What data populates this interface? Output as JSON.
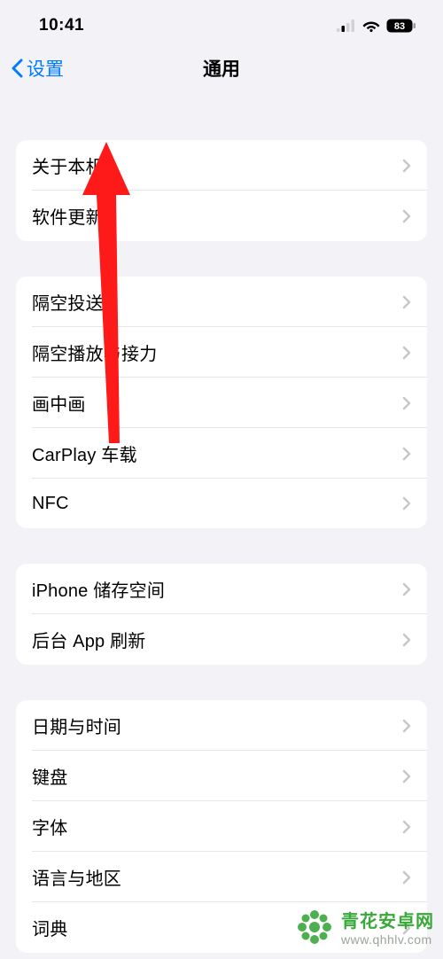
{
  "status": {
    "time": "10:41",
    "battery": "83"
  },
  "nav": {
    "back": "设置",
    "title": "通用"
  },
  "groups": [
    {
      "rows": [
        {
          "label": "关于本机",
          "name": "about"
        },
        {
          "label": "软件更新",
          "name": "software-update"
        }
      ]
    },
    {
      "rows": [
        {
          "label": "隔空投送",
          "name": "airdrop"
        },
        {
          "label": "隔空播放与接力",
          "name": "airplay-handoff"
        },
        {
          "label": "画中画",
          "name": "pip"
        },
        {
          "label": "CarPlay 车载",
          "name": "carplay"
        },
        {
          "label": "NFC",
          "name": "nfc"
        }
      ]
    },
    {
      "rows": [
        {
          "label": "iPhone 储存空间",
          "name": "iphone-storage"
        },
        {
          "label": "后台 App 刷新",
          "name": "background-refresh"
        }
      ]
    },
    {
      "rows": [
        {
          "label": "日期与时间",
          "name": "date-time"
        },
        {
          "label": "键盘",
          "name": "keyboard"
        },
        {
          "label": "字体",
          "name": "fonts"
        },
        {
          "label": "语言与地区",
          "name": "language-region"
        },
        {
          "label": "词典",
          "name": "dictionary"
        }
      ]
    }
  ],
  "watermark": {
    "title": "青花安卓网",
    "url": "www.qhhlv.com"
  },
  "colors": {
    "accent": "#007aff",
    "arrow": "#ff1a1a",
    "watermark": "#38a838"
  }
}
